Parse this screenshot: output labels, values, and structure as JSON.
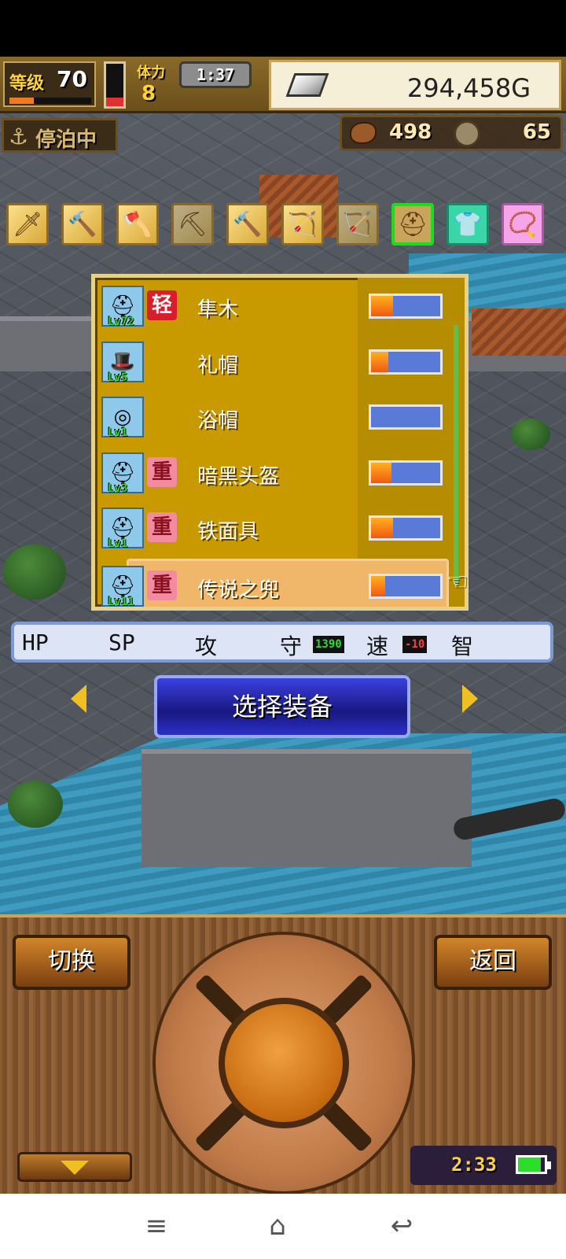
{
  "hud": {
    "level_label": "等级",
    "level_value": "70",
    "level_progress": 0.3,
    "red_meter_level": 0.2,
    "stamina_label": "体力",
    "stamina_value": "8",
    "timer": "1:37",
    "gold": "294,458G",
    "anchor_label": "停泊中",
    "resource1": "498",
    "resource2": "65"
  },
  "categories": [
    {
      "icon": "sword-icon",
      "glyph": "🗡"
    },
    {
      "icon": "mace-icon",
      "glyph": "🔨"
    },
    {
      "icon": "axe-icon",
      "glyph": "🪓"
    },
    {
      "icon": "spear-icon",
      "glyph": "⛏"
    },
    {
      "icon": "hammer-icon",
      "glyph": "🔨"
    },
    {
      "icon": "bow-icon",
      "glyph": "🏹"
    },
    {
      "icon": "crossbow-icon",
      "glyph": "🏹"
    },
    {
      "icon": "helmet-icon",
      "glyph": "⛑"
    },
    {
      "icon": "armor-icon",
      "glyph": "👕"
    },
    {
      "icon": "accessory-icon",
      "glyph": "📿"
    }
  ],
  "equipment": [
    {
      "name": "隼木",
      "lv": "Lv72",
      "tag": "轻",
      "tag_type": "light",
      "value": 0.32,
      "glyph": "⛑"
    },
    {
      "name": "礼帽",
      "lv": "Lv5",
      "tag": "",
      "tag_type": "",
      "value": 0.25,
      "glyph": "🎩"
    },
    {
      "name": "浴帽",
      "lv": "Lv1",
      "tag": "",
      "tag_type": "",
      "value": 0.0,
      "glyph": "◎"
    },
    {
      "name": "暗黑头盔",
      "lv": "Lv3",
      "tag": "重",
      "tag_type": "heavy",
      "value": 0.3,
      "glyph": "⛑"
    },
    {
      "name": "铁面具",
      "lv": "Lv1",
      "tag": "重",
      "tag_type": "heavy",
      "value": 0.32,
      "glyph": "⛑"
    },
    {
      "name": "传说之兜",
      "lv": "Lv11",
      "tag": "重",
      "tag_type": "heavy",
      "value": 0.2,
      "glyph": "⛑"
    }
  ],
  "stats": {
    "hp": "HP",
    "sp": "SP",
    "atk": "攻",
    "def": "守",
    "def_badge": "1390",
    "spd": "速",
    "spd_badge": "-10",
    "int": "智"
  },
  "select_button": "选择装备",
  "controls": {
    "switch": "切换",
    "back": "返回",
    "clock": "2:33",
    "battery_level": 0.85
  },
  "colors": {
    "accent_gold": "#c89a00",
    "select_blue": "#1a1880",
    "hp_bar_fill": "#f05a10"
  }
}
